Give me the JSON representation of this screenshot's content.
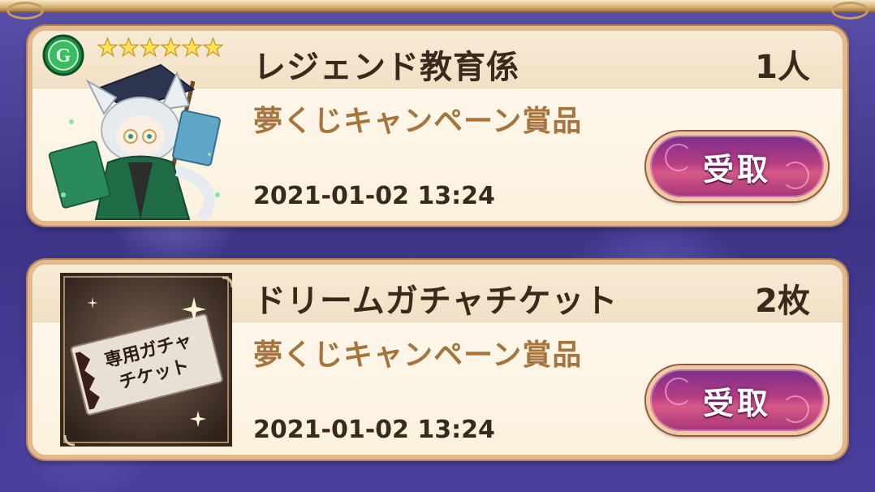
{
  "items": [
    {
      "title": "レジェンド教育係",
      "quantity": "1人",
      "source": "夢くじキャンペーン賞品",
      "date": "2021-01-02 13:24",
      "button_label": "受取",
      "rarity_stars": 6,
      "badge_letter": "G",
      "thumbnail": "character-portrait"
    },
    {
      "title": "ドリームガチャチケット",
      "quantity": "2枚",
      "source": "夢くじキャンペーン賞品",
      "date": "2021-01-02 13:24",
      "button_label": "受取",
      "thumbnail": "gacha-ticket",
      "ticket_text_line1": "専用ガチャ",
      "ticket_text_line2": "チケット"
    }
  ],
  "colors": {
    "title_text": "#3a2a1c",
    "source_text": "#a7743e",
    "button_fill": "#b73c86",
    "card_border": "#e2b98b"
  }
}
